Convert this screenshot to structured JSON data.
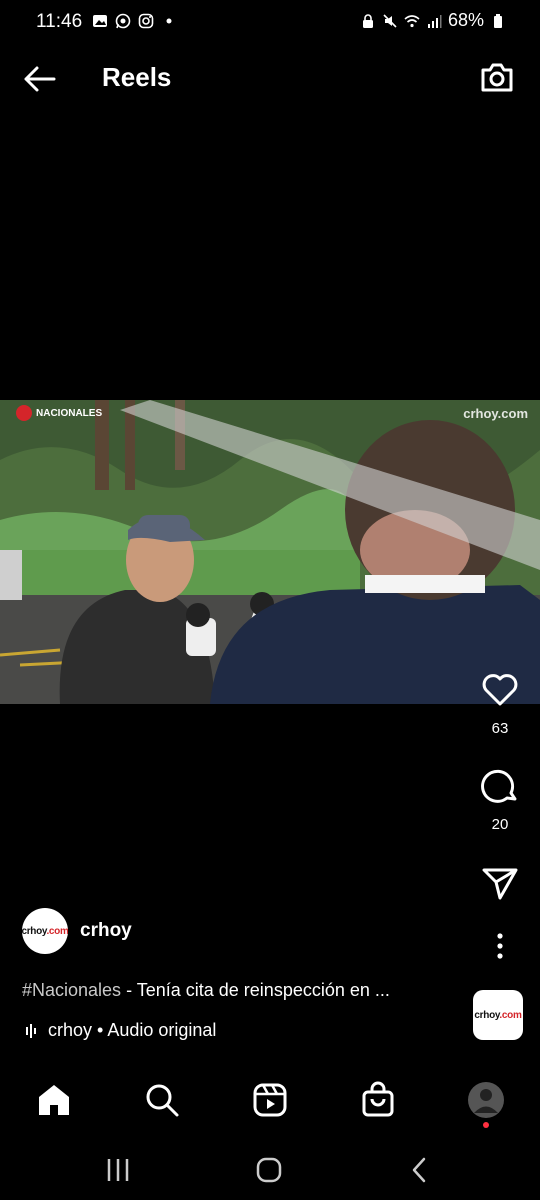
{
  "status": {
    "time": "11:46",
    "battery": "68%",
    "left_icons": [
      "gallery-icon",
      "whatsapp-icon",
      "instagram-icon",
      "dot-icon"
    ],
    "right_icons": [
      "lock-icon",
      "mute-icon",
      "wifi-icon",
      "signal-icon",
      "battery-icon"
    ]
  },
  "header": {
    "title": "Reels"
  },
  "video": {
    "tag": "NACIONALES",
    "watermark": "crhoy.com"
  },
  "actions": {
    "likes": "63",
    "comments": "20"
  },
  "post": {
    "author": "crhoy",
    "logo_black": "crhoy",
    "logo_red": ".com",
    "caption_tag": "#Nacionales",
    "caption_text": " - Tenía cita de reinspección en ...",
    "audio": "crhoy • Audio original"
  },
  "colors": {
    "background": "#000000",
    "text": "#ffffff",
    "notification_dot": "#ff3040",
    "brand_red": "#d4252a"
  }
}
